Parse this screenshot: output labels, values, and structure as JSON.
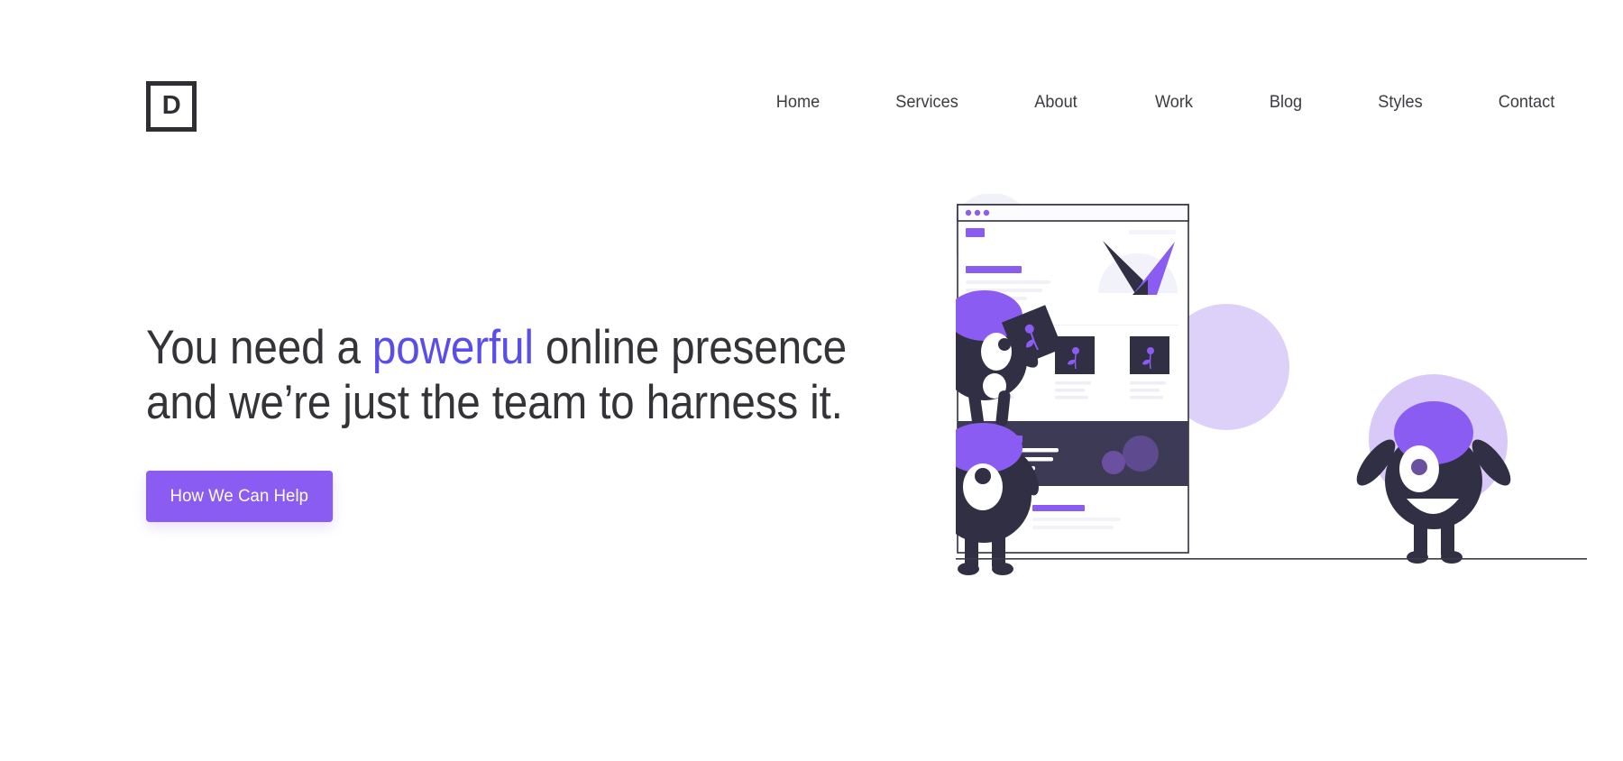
{
  "brand": {
    "logo_letter": "D",
    "logo_icon": "square-outline-logo"
  },
  "nav": {
    "items": [
      {
        "label": "Home"
      },
      {
        "label": "Services"
      },
      {
        "label": "About"
      },
      {
        "label": "Work"
      },
      {
        "label": "Blog"
      },
      {
        "label": "Styles"
      },
      {
        "label": "Contact"
      }
    ]
  },
  "hero": {
    "headline_part1": "You need a ",
    "headline_accent": "powerful",
    "headline_part2": " online presence",
    "headline_line2": "and we’re just the team to harness it.",
    "cta_label": "How We Can Help"
  },
  "colors": {
    "accent_text": "#5a4ee8",
    "button_purple": "#8b5cf2",
    "heading_dark": "#333338",
    "nav_text": "#3b3b42",
    "illustration_dark": "#302f44",
    "illustration_purple": "#8b5cf2",
    "illustration_light_purple": "#d4c4f7",
    "illustration_pale": "#f2f3f9",
    "page_background": "#ffffff"
  },
  "illustration": {
    "name": "team-characters-website-mockup",
    "elements": [
      {
        "name": "browser-window-mockup"
      },
      {
        "name": "character-left-upper"
      },
      {
        "name": "character-left-lower"
      },
      {
        "name": "character-right"
      },
      {
        "name": "ground-line"
      }
    ]
  }
}
